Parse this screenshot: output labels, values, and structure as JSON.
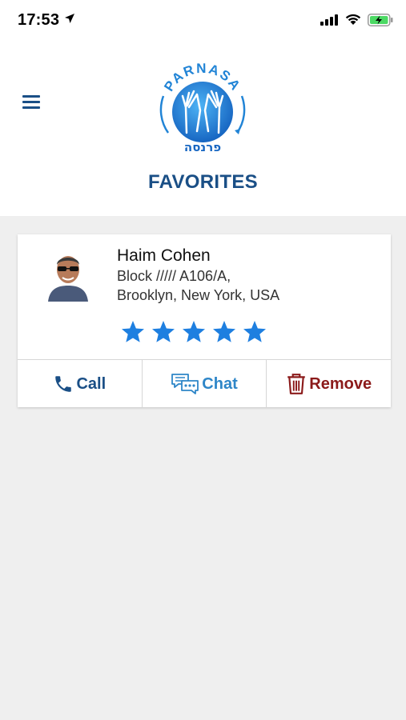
{
  "status_bar": {
    "time": "17:53"
  },
  "header": {
    "logo_top_text": "PARNASA",
    "logo_bottom_text": "פרנסה",
    "title": "FAVORITES"
  },
  "favorites": [
    {
      "name": "Haim Cohen",
      "address_line1": "Block ///// A106/A,",
      "address_line2": "Brooklyn, New York, USA",
      "rating": 5,
      "actions": {
        "call": "Call",
        "chat": "Chat",
        "remove": "Remove"
      }
    }
  ],
  "colors": {
    "primary": "#1a4f86",
    "star": "#1e7fe0",
    "chat": "#2e86c8",
    "remove": "#8b1a1a"
  }
}
